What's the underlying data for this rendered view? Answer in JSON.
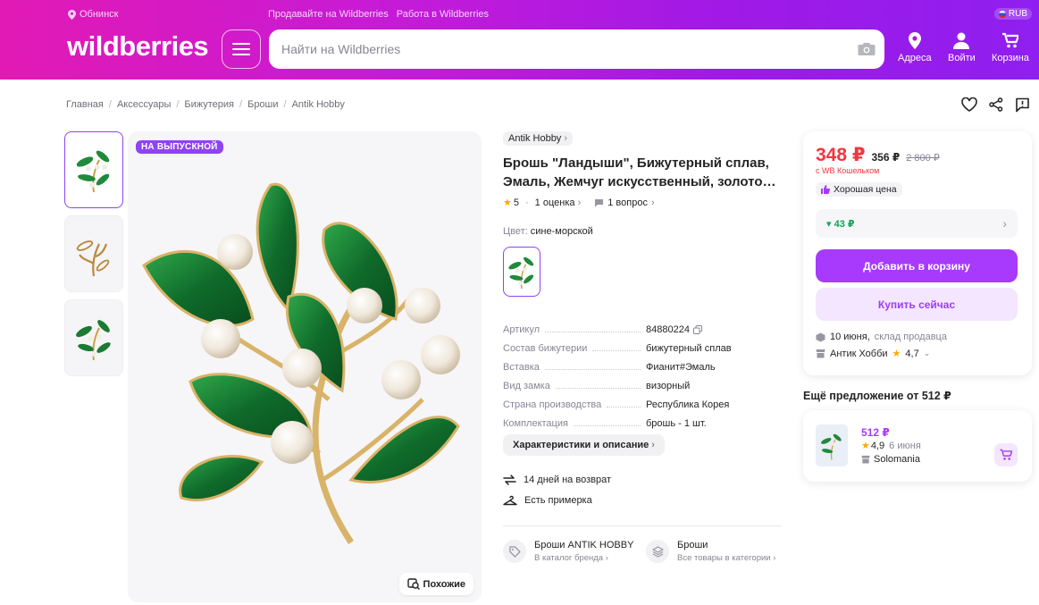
{
  "header": {
    "city": "Обнинск",
    "links": [
      "Продавайте на Wildberries",
      "Работа в Wildberries"
    ],
    "currency": "RUB",
    "logo": "wildberries",
    "search_placeholder": "Найти на Wildberries",
    "icons": [
      {
        "label": "Адреса",
        "icon": "map-pin-icon"
      },
      {
        "label": "Войти",
        "icon": "user-icon"
      },
      {
        "label": "Корзина",
        "icon": "cart-icon"
      }
    ]
  },
  "breadcrumbs": [
    "Главная",
    "Аксессуары",
    "Бижутерия",
    "Броши",
    "Antik Hobby"
  ],
  "gallery": {
    "badge": "НА ВЫПУСКНОЙ",
    "similar_label": "Похожие"
  },
  "product": {
    "brand": "Antik Hobby",
    "title": "Брошь \"Ландыши\", Бижутерный сплав, Эмаль, Жемчуг искусственный, золото…",
    "rating": "5",
    "reviews": "1 оценка",
    "questions": "1 вопрос",
    "color_label": "Цвет:",
    "color_value": "сине-морской",
    "specs": [
      {
        "key": "Артикул",
        "value": "84880224"
      },
      {
        "key": "Состав бижутерии",
        "value": "бижутерный сплав"
      },
      {
        "key": "Вставка",
        "value": "Фианит#Эмаль"
      },
      {
        "key": "Вид замка",
        "value": "визорный"
      },
      {
        "key": "Страна производства",
        "value": "Республика Корея"
      },
      {
        "key": "Комплектация",
        "value": "брошь - 1 шт."
      }
    ],
    "char_button": "Характеристики и описание",
    "return": "14 дней на возврат",
    "fitting": "Есть примерка",
    "brand_link": {
      "title": "Броши ANTIK HOBBY",
      "sub": "В каталог бренда"
    },
    "category_link": {
      "title": "Броши",
      "sub": "Все товары в категории"
    }
  },
  "buy": {
    "price": "348 ₽",
    "price_mid": "356 ₽",
    "price_old": "2 800 ₽",
    "wallet": "с WB Кошельком",
    "good_price": "Хорошая цена",
    "delta": "▾ 43 ₽",
    "add_to_cart": "Добавить в корзину",
    "buy_now": "Купить сейчас",
    "delivery_date": "10 июня,",
    "delivery_place": "склад продавца",
    "seller": "Антик Хобби",
    "seller_rating": "4,7"
  },
  "another": {
    "title": "Ещё предложение от 512 ₽",
    "price": "512 ₽",
    "rating": "4,9",
    "date": "6 июня",
    "seller": "Solomania"
  },
  "colors": {
    "accent": "#a73afd",
    "price": "#f5353d",
    "green": "#14a15c"
  }
}
